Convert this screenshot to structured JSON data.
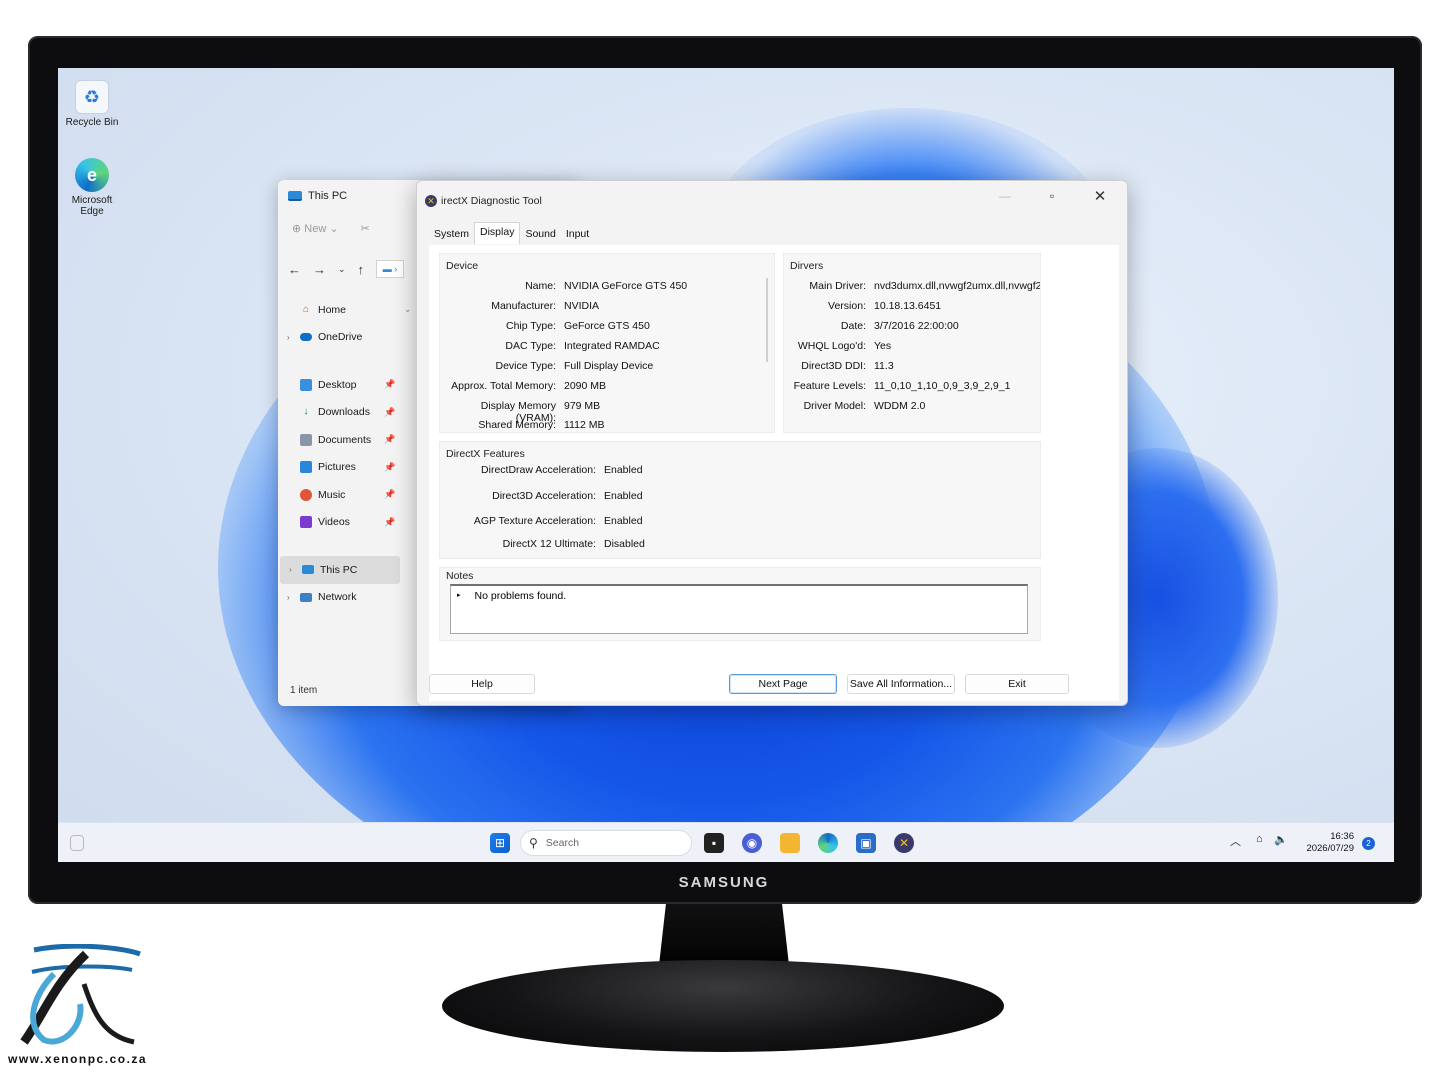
{
  "desktop": {
    "icons": [
      {
        "label": "Recycle Bin"
      },
      {
        "label": "Microsoft Edge"
      }
    ]
  },
  "explorer": {
    "title": "This PC",
    "toolbar": {
      "new_label": "New"
    },
    "nav": {
      "home": "Home",
      "onedrive": "OneDrive",
      "desktop": "Desktop",
      "downloads": "Downloads",
      "documents": "Documents",
      "pictures": "Pictures",
      "music": "Music",
      "videos": "Videos",
      "thispc": "This PC",
      "network": "Network"
    },
    "status": "1 item"
  },
  "dxdiag": {
    "title": "irectX Diagnostic Tool",
    "tabs": [
      "System",
      "Display",
      "Sound",
      "Input"
    ],
    "active_tab": "Display",
    "device": {
      "title": "Device",
      "rows": [
        {
          "label": "Name:",
          "value": "NVIDIA GeForce GTS 450"
        },
        {
          "label": "Manufacturer:",
          "value": "NVIDIA"
        },
        {
          "label": "Chip Type:",
          "value": "GeForce GTS 450"
        },
        {
          "label": "DAC Type:",
          "value": "Integrated RAMDAC"
        },
        {
          "label": "Device Type:",
          "value": "Full Display Device"
        },
        {
          "label": "Approx. Total Memory:",
          "value": "2090 MB"
        },
        {
          "label": "Display Memory (VRAM):",
          "value": "979 MB"
        },
        {
          "label": "Shared Memory:",
          "value": "1112 MB"
        }
      ]
    },
    "drivers": {
      "title": "Dirvers",
      "rows": [
        {
          "label": "Main Driver:",
          "value": "nvd3dumx.dll,nvwgf2umx.dll,nvwgf2"
        },
        {
          "label": "Version:",
          "value": "10.18.13.6451"
        },
        {
          "label": "Date:",
          "value": "3/7/2016 22:00:00"
        },
        {
          "label": "WHQL Logo'd:",
          "value": "Yes"
        },
        {
          "label": "Direct3D DDI:",
          "value": "11.3"
        },
        {
          "label": "Feature Levels:",
          "value": "11_0,10_1,10_0,9_3,9_2,9_1"
        },
        {
          "label": "Driver Model:",
          "value": "WDDM 2.0"
        }
      ]
    },
    "features": {
      "title": "DirectX Features",
      "rows": [
        {
          "label": "DirectDraw Acceleration:",
          "value": "Enabled"
        },
        {
          "label": "Direct3D Acceleration:",
          "value": "Enabled"
        },
        {
          "label": "AGP Texture Acceleration:",
          "value": "Enabled"
        },
        {
          "label": "DirectX 12 Ultimate:",
          "value": "Disabled"
        }
      ]
    },
    "notes": {
      "title": "Notes",
      "text": "No problems found."
    },
    "buttons": {
      "help": "Help",
      "next": "Next Page",
      "save": "Save All Information...",
      "exit": "Exit"
    }
  },
  "taskbar": {
    "search_placeholder": "Search",
    "time": "16:36",
    "date": "2026/07/29",
    "notifications": "2"
  },
  "monitor": {
    "brand": "SAMSUNG"
  },
  "watermark": {
    "site": "www.xenonpc.co.za"
  },
  "colors": {
    "accent": "#1a62d6",
    "bloom": "#1556e8"
  }
}
